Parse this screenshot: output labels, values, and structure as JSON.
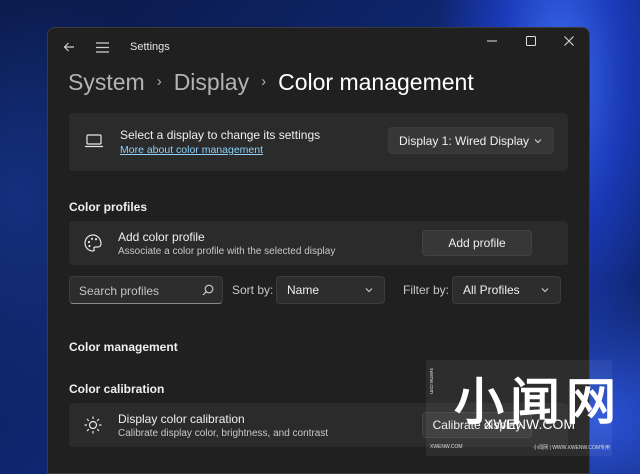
{
  "window": {
    "title": "Settings"
  },
  "breadcrumb": {
    "items": [
      "System",
      "Display"
    ],
    "current": "Color management"
  },
  "display_card": {
    "title": "Select a display to change its settings",
    "link": "More about color management",
    "selected_display": "Display 1: Wired Display"
  },
  "color_profiles": {
    "section_title": "Color profiles",
    "add_title": "Add color profile",
    "add_subtitle": "Associate a color profile with the selected display",
    "add_button": "Add profile",
    "search_placeholder": "Search profiles",
    "sort_label": "Sort by:",
    "sort_value": "Name",
    "filter_label": "Filter by:",
    "filter_value": "All Profiles"
  },
  "color_management": {
    "section_title": "Color management"
  },
  "color_calibration": {
    "section_title": "Color calibration",
    "title": "Display color calibration",
    "subtitle": "Calibrate display color, brightness, and contrast",
    "button": "Calibrate display"
  },
  "watermark": {
    "chinese": "小闻网",
    "english": "XWENW.COM",
    "side_text": "xwenw.com",
    "bottom_left": "XWENW.COM",
    "bottom_right": "小闻网 | WWW.XWENW.COM专用"
  },
  "colors": {
    "accent_link": "#8fd1f7",
    "window_bg": "#202020",
    "card_bg": "#2b2b2b"
  }
}
